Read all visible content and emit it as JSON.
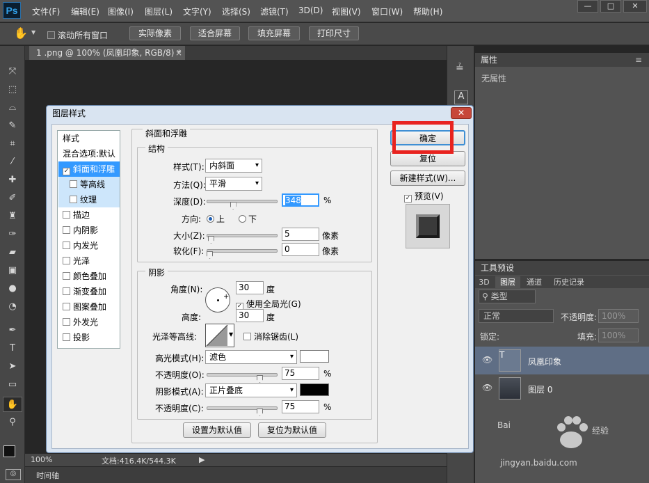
{
  "app": {
    "logo": "Ps"
  },
  "menu": [
    "文件(F)",
    "编辑(E)",
    "图像(I)",
    "图层(L)",
    "文字(Y)",
    "选择(S)",
    "滤镜(T)",
    "3D(D)",
    "视图(V)",
    "窗口(W)",
    "帮助(H)"
  ],
  "window_controls": [
    "—",
    "□",
    "✕"
  ],
  "options_bar": {
    "scroll_all": "滚动所有窗口",
    "actual_pixels": "实际像素",
    "fit_screen": "适合屏幕",
    "fill_screen": "填充屏幕",
    "print_size": "打印尺寸"
  },
  "document_tab": {
    "title": "1 .png @ 100% (凤凰印象, RGB/8) *",
    "close": "×"
  },
  "status_bar": {
    "zoom": "100%",
    "doc_info": "文档:416.4K/544.3K"
  },
  "timeline_label": "时间轴",
  "properties_panel": {
    "title": "属性",
    "empty_text": "无属性"
  },
  "tool_presets_title": "工具预设",
  "layers_panel": {
    "tabs": [
      "3D",
      "图层",
      "通道",
      "历史记录"
    ],
    "active_tab": "图层",
    "filter_kind": "类型",
    "blend_mode": "正常",
    "opacity_label": "不透明度:",
    "opacity_value": "100%",
    "lock_label": "锁定:",
    "fill_label": "填充:",
    "fill_value": "100%",
    "layers": [
      {
        "name": "凤凰印象",
        "thumb": "T",
        "selected": true
      },
      {
        "name": "图层 0",
        "thumb": "",
        "selected": false
      }
    ]
  },
  "dialog": {
    "title": "图层样式",
    "close": "✕",
    "styles_header": "样式",
    "blend_options": "混合选项:默认",
    "style_items": [
      {
        "label": "斜面和浮雕",
        "checked": true,
        "state": "selected"
      },
      {
        "label": "等高线",
        "checked": false,
        "state": "sub"
      },
      {
        "label": "纹理",
        "checked": false,
        "state": "sub"
      },
      {
        "label": "描边",
        "checked": false,
        "state": "normal"
      },
      {
        "label": "内阴影",
        "checked": false,
        "state": "normal"
      },
      {
        "label": "内发光",
        "checked": false,
        "state": "normal"
      },
      {
        "label": "光泽",
        "checked": false,
        "state": "normal"
      },
      {
        "label": "颜色叠加",
        "checked": false,
        "state": "normal"
      },
      {
        "label": "渐变叠加",
        "checked": false,
        "state": "normal"
      },
      {
        "label": "图案叠加",
        "checked": false,
        "state": "normal"
      },
      {
        "label": "外发光",
        "checked": false,
        "state": "normal"
      },
      {
        "label": "投影",
        "checked": false,
        "state": "normal"
      }
    ],
    "bevel": {
      "title": "斜面和浮雕",
      "structure": "结构",
      "style_label": "样式(T):",
      "style_value": "内斜面",
      "technique_label": "方法(Q):",
      "technique_value": "平滑",
      "depth_label": "深度(D):",
      "depth_value": "348",
      "depth_level": 0.35,
      "percent": "%",
      "direction_label": "方向:",
      "direction_up": "上",
      "direction_down": "下",
      "size_label": "大小(Z):",
      "size_value": "5",
      "size_level": 0.02,
      "soften_label": "软化(F):",
      "soften_value": "0",
      "soften_level": 0.0,
      "pixels": "像素"
    },
    "shading": {
      "title": "阴影",
      "angle_label": "角度(N):",
      "angle_value": "30",
      "degree": "度",
      "global_light": "使用全局光(G)",
      "altitude_label": "高度:",
      "altitude_value": "30",
      "gloss_label": "光泽等高线:",
      "anti_alias": "消除锯齿(L)",
      "highlight_mode_label": "高光模式(H):",
      "highlight_mode": "滤色",
      "highlight_color": "#ffffff",
      "highlight_opacity_label": "不透明度(O):",
      "highlight_opacity": "75",
      "highlight_opacity_level": 0.75,
      "shadow_mode_label": "阴影模式(A):",
      "shadow_mode": "正片叠底",
      "shadow_color": "#000000",
      "shadow_opacity_label": "不透明度(C):",
      "shadow_opacity": "75",
      "shadow_opacity_level": 0.75,
      "percent": "%"
    },
    "make_default": "设置为默认值",
    "reset_default": "复位为默认值",
    "ok": "确定",
    "reset": "复位",
    "new_style": "新建样式(W)...",
    "preview": "预览(V)"
  },
  "watermark": {
    "brand": "Bai",
    "brand_cn": "经验",
    "url": "jingyan.baidu.com"
  }
}
